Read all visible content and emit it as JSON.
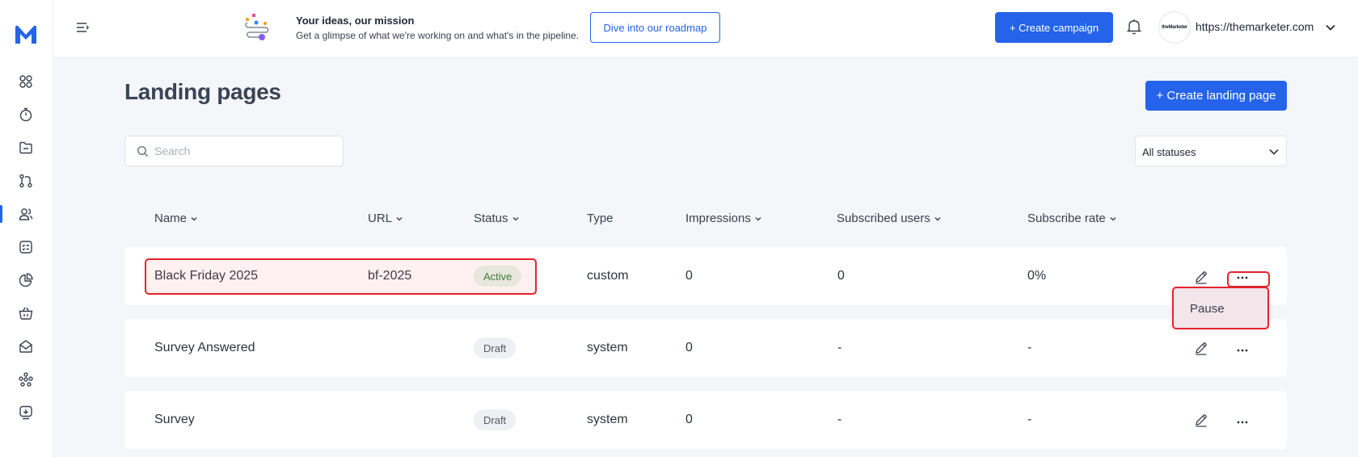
{
  "sidebar": {
    "logo": "M",
    "items": [
      {
        "icon": "grid-icon"
      },
      {
        "icon": "stopwatch-icon"
      },
      {
        "icon": "folder-icon"
      },
      {
        "icon": "git-branch-icon"
      },
      {
        "icon": "users-icon",
        "active": true
      },
      {
        "icon": "checklist-icon"
      },
      {
        "icon": "pie-chart-icon"
      },
      {
        "icon": "basket-icon"
      },
      {
        "icon": "mail-icon"
      },
      {
        "icon": "network-icon"
      },
      {
        "icon": "download-icon"
      }
    ]
  },
  "topbar": {
    "promo_title": "Your ideas, our mission",
    "promo_subtitle": "Get a glimpse of what we're working on and what's in the pipeline.",
    "roadmap_label": "Dive into our roadmap",
    "create_campaign_label": "+ Create campaign",
    "account_logo_text": "theMarketer",
    "account_url": "https://themarketer.com"
  },
  "main": {
    "title": "Landing pages",
    "create_label": "+ Create landing page",
    "search_placeholder": "Search",
    "status_filter": "All statuses"
  },
  "table": {
    "headers": {
      "name": "Name",
      "url": "URL",
      "status": "Status",
      "type": "Type",
      "impressions": "Impressions",
      "subscribed": "Subscribed users",
      "rate": "Subscribe rate"
    },
    "rows": [
      {
        "name": "Black Friday 2025",
        "url": "bf-2025",
        "status": "Active",
        "type": "custom",
        "impressions": "0",
        "subscribed": "0",
        "rate": "0%"
      },
      {
        "name": "Survey Answered",
        "url": "",
        "status": "Draft",
        "type": "system",
        "impressions": "0",
        "subscribed": "-",
        "rate": "-"
      },
      {
        "name": "Survey",
        "url": "",
        "status": "Draft",
        "type": "system",
        "impressions": "0",
        "subscribed": "-",
        "rate": "-"
      }
    ]
  },
  "row_menu": {
    "pause_label": "Pause"
  },
  "colors": {
    "accent": "#2563eb",
    "highlight": "#e5242b",
    "active_badge_bg": "#e6f4ea",
    "active_badge_text": "#2e7d32"
  }
}
